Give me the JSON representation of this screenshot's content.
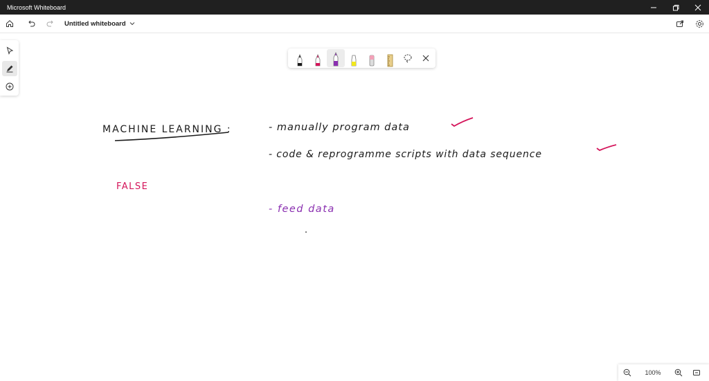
{
  "window": {
    "app_title": "Microsoft Whiteboard"
  },
  "toolbar": {
    "board_title": "Untitled whiteboard"
  },
  "canvas": {
    "ink": {
      "heading": "MACHINE LEARNING :",
      "point1": "- manually program data",
      "point2": "- code & reprogramme scripts with data sequence",
      "false_label": "FALSE",
      "point3": "- feed data"
    }
  },
  "zoom": {
    "level": "100%"
  },
  "colors": {
    "black_pen": "#1a1a1a",
    "red_pen": "#d4145a",
    "purple_pen": "#8a2fb0",
    "titlebar": "#202020"
  },
  "icons": [
    "home-icon",
    "undo-icon",
    "redo-icon",
    "chevron-down-icon",
    "share-icon",
    "settings-icon",
    "select-icon",
    "pen-icon",
    "add-icon",
    "lasso-icon",
    "close-icon",
    "zoom-out-icon",
    "zoom-in-icon",
    "fit-screen-icon"
  ]
}
